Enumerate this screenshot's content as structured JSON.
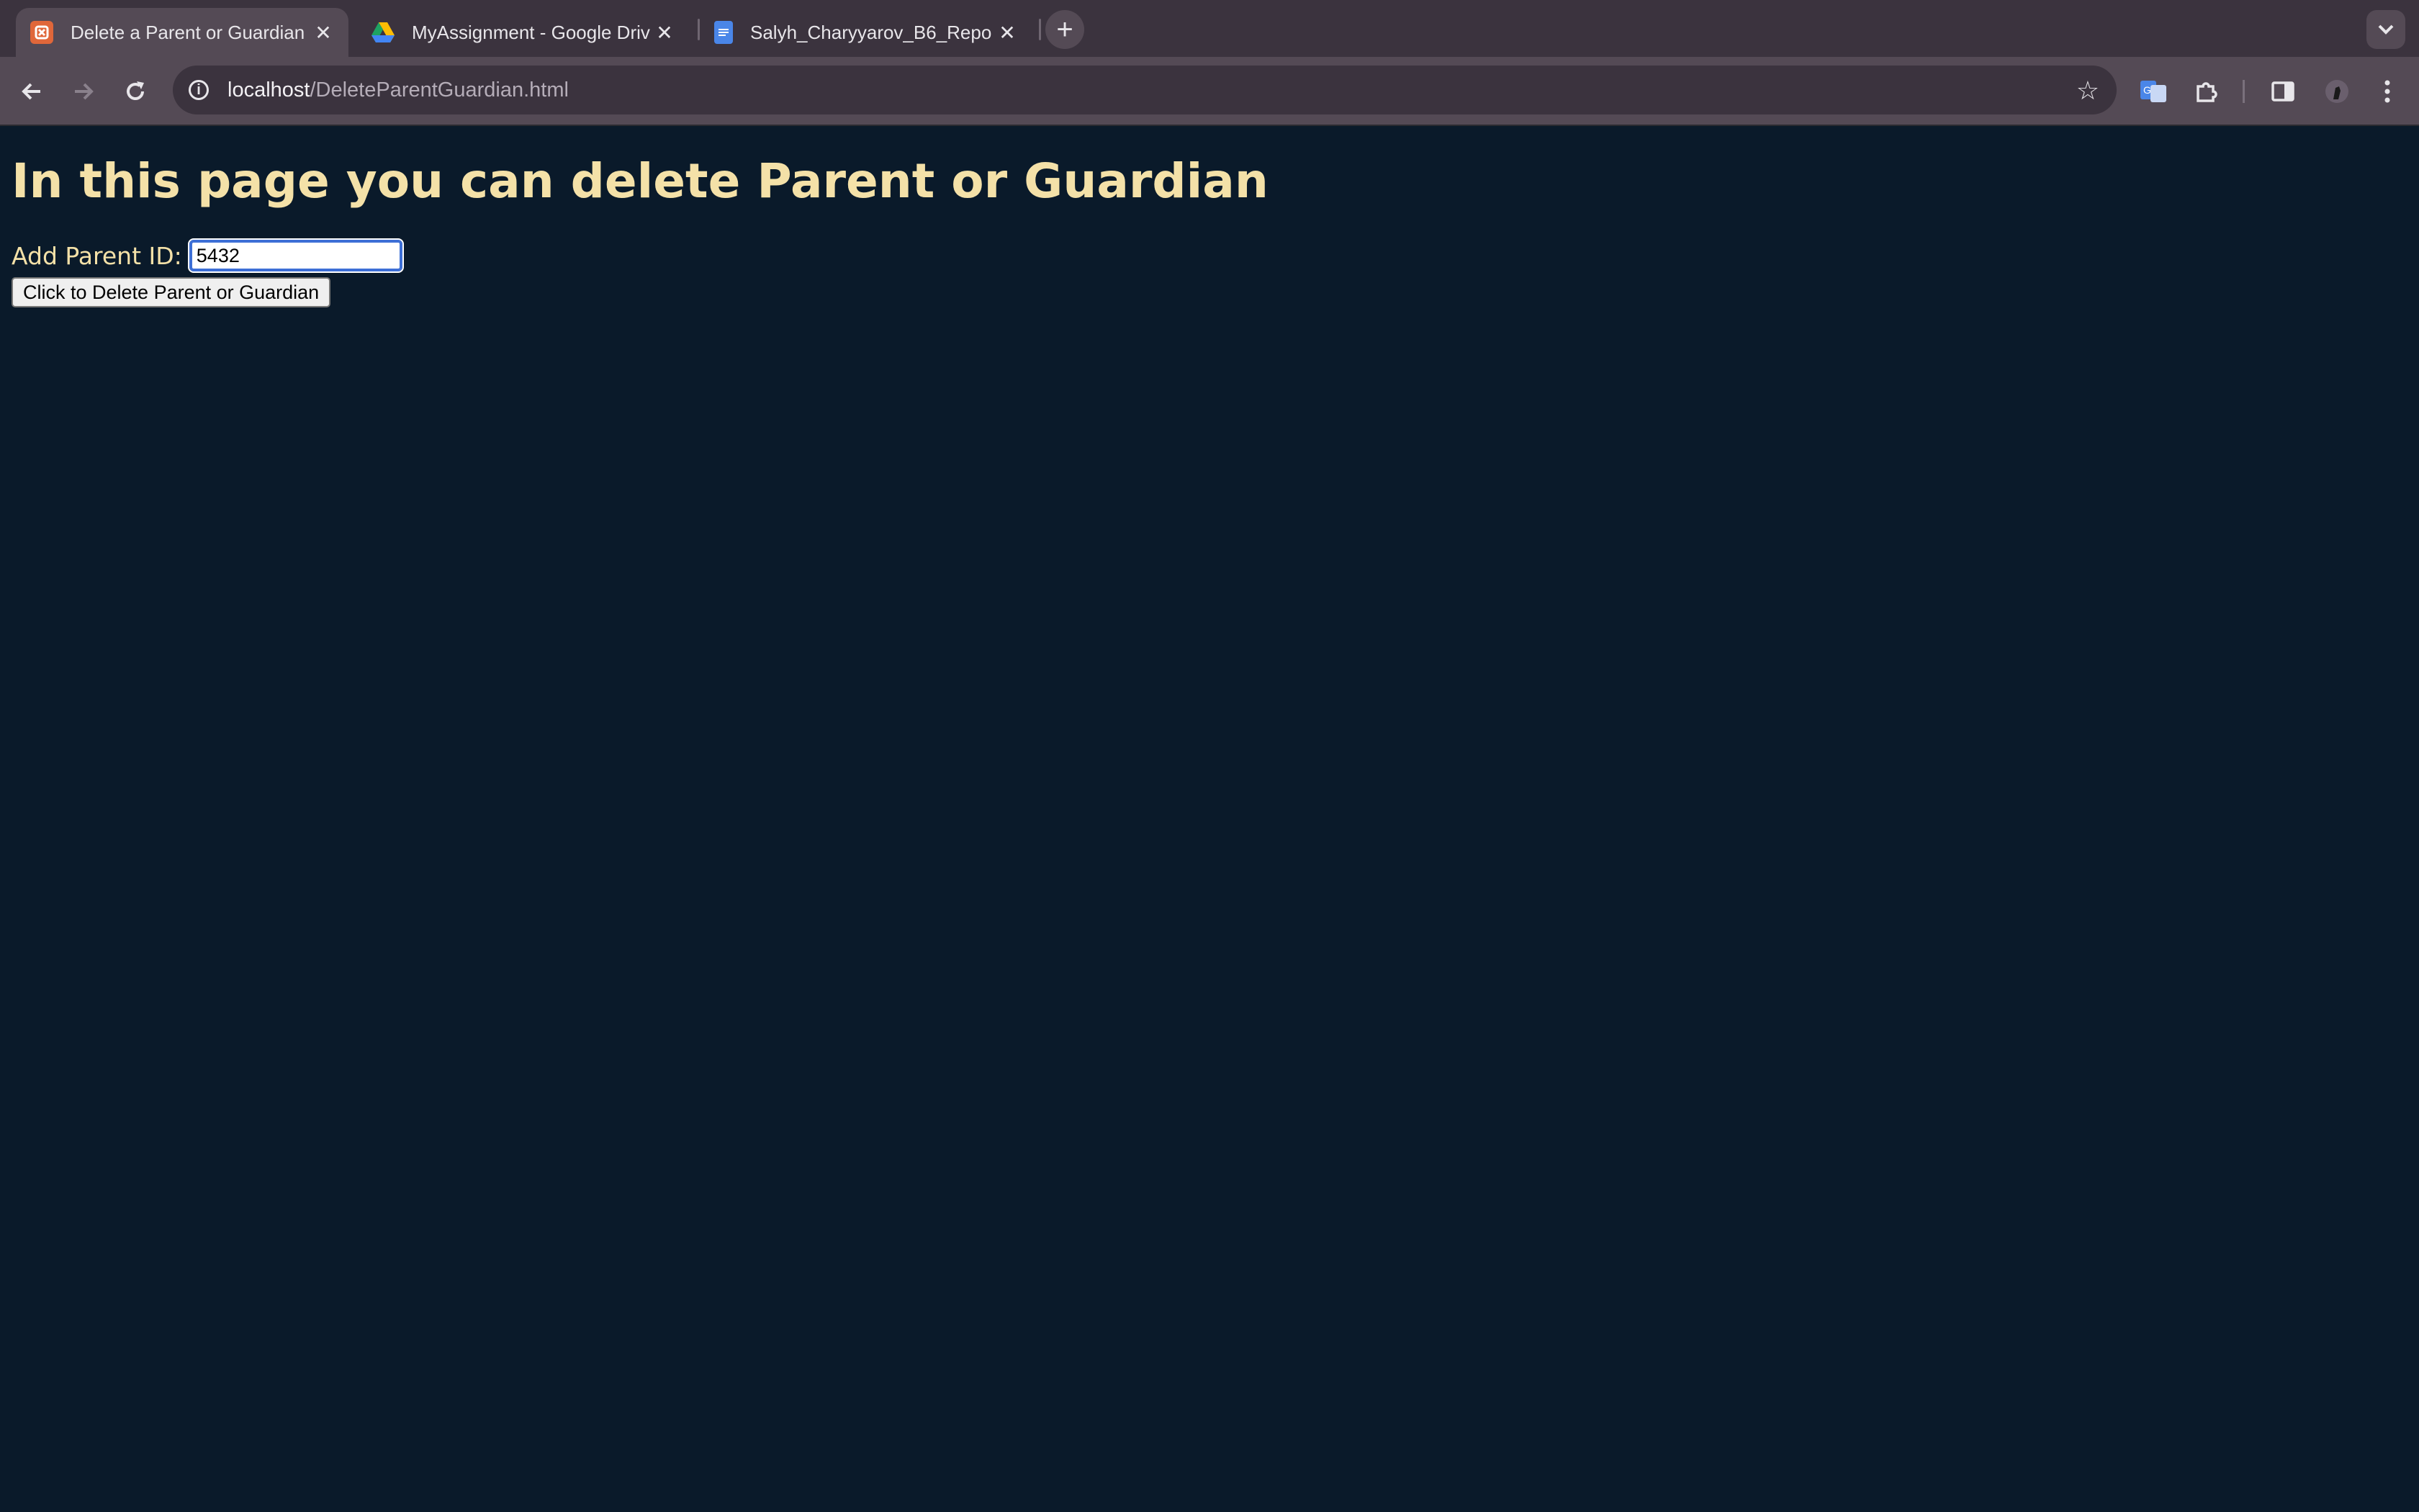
{
  "browser": {
    "tabs": [
      {
        "title": "Delete a Parent or Guardian",
        "active": true,
        "favicon": "xampp-icon"
      },
      {
        "title": "MyAssignment - Google Driv",
        "active": false,
        "favicon": "google-drive-icon"
      },
      {
        "title": "Salyh_Charyyarov_B6_Repo",
        "active": false,
        "favicon": "google-docs-icon"
      }
    ],
    "url_host": "localhost",
    "url_path": "/DeleteParentGuardian.html"
  },
  "page": {
    "heading": "In this page you can delete Parent or Guardian",
    "field_label": "Add Parent ID:",
    "field_value": "5432",
    "button_label": "Click to Delete Parent or Guardian"
  },
  "colors": {
    "page_background": "#0a1a2a",
    "heading_color": "#f4e1a8",
    "tabstrip": "#3b333e",
    "toolbar": "#544a55"
  }
}
